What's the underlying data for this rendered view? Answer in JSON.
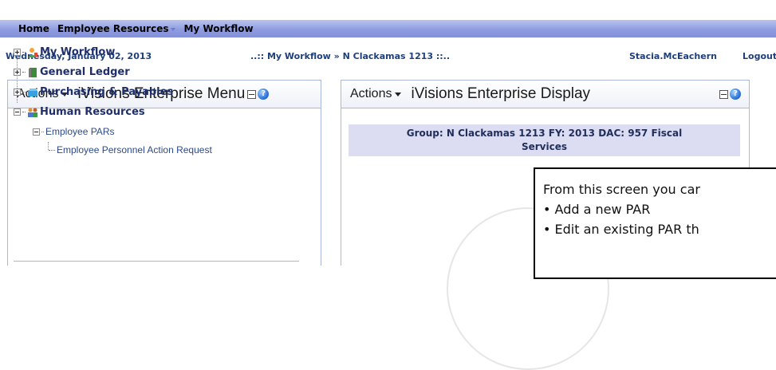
{
  "nav": {
    "home": "Home",
    "employee_resources": "Employee Resources",
    "my_workflow": "My Workflow"
  },
  "info": {
    "date": "Wednesday, January 02, 2013",
    "breadcrumb": "..:: My Workflow » N Clackamas 1213 ::..",
    "user": "Stacia.McEachern",
    "logout": "Logout"
  },
  "left_panel": {
    "actions": "Actions",
    "title": "iVisions Enterprise Menu",
    "tree": {
      "my_workflow": "My Workflow",
      "general_ledger": "General Ledger",
      "purchasing": "Purchasing & Payables",
      "human_resources": "Human Resources",
      "employee_pars": "Employee PARs",
      "employee_par_request": "Employee Personnel Action Request"
    }
  },
  "right_panel": {
    "actions": "Actions",
    "title": "iVisions Enterprise Display",
    "group_line1": "Group: N Clackamas 1213   FY: 2013   DAC: 957 Fiscal",
    "group_line2": "Services"
  },
  "callout": {
    "line1": "From this screen you car",
    "line2": "• Add a new PAR",
    "line3": "• Edit an existing PAR th"
  },
  "icons": {
    "help": "help-icon",
    "collapse": "collapse-icon",
    "workflow": "workflow-icon",
    "ledger": "ledger-icon",
    "purchasing": "purchasing-icon",
    "hr": "people-icon"
  },
  "colors": {
    "navbar": "#8f9ce0",
    "link_text": "#1f3f7a",
    "group_box": "#dcdcf2"
  }
}
